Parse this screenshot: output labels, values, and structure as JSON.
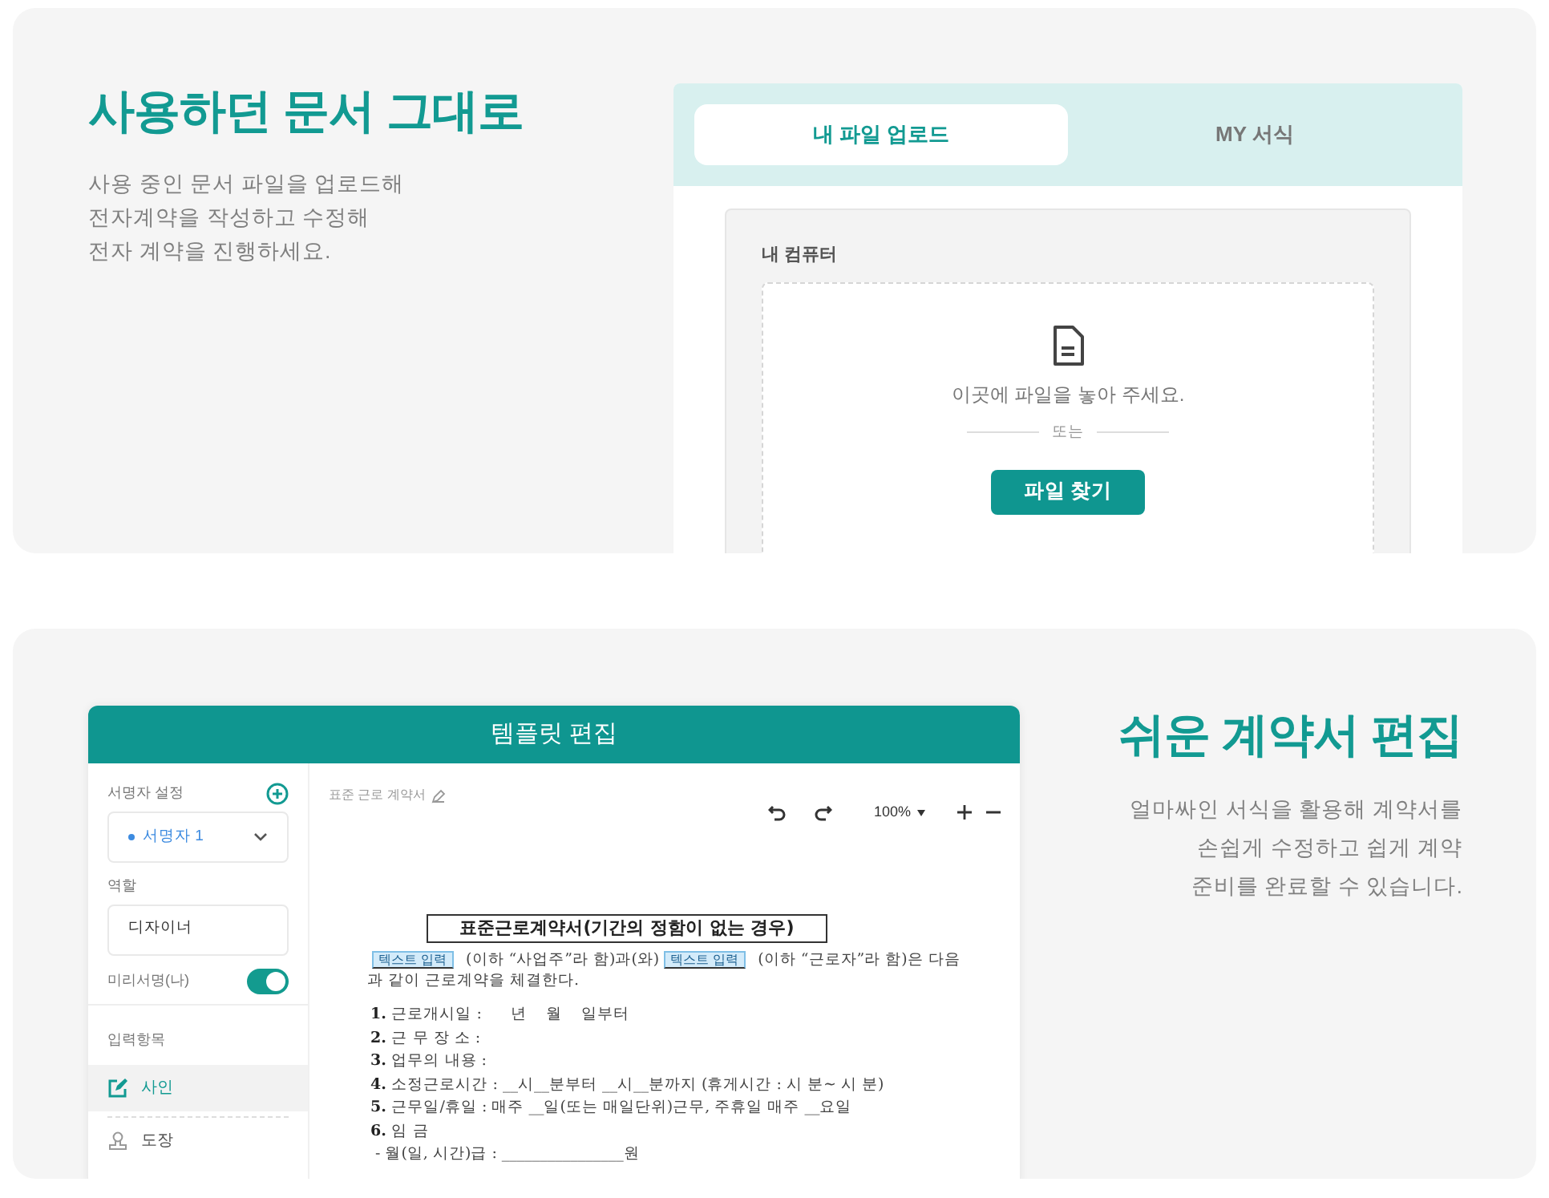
{
  "intro": {
    "title": "사용하던 문서 그대로",
    "lines": [
      "사용 중인 문서 파일을 업로드해",
      "전자계약을 작성하고 수정해",
      "전자 계약을 진행하세요."
    ]
  },
  "upload_panel": {
    "tabs": [
      {
        "label": "내 파일 업로드",
        "selected": true
      },
      {
        "label": "MY 서식",
        "selected": false
      }
    ],
    "source_label": "내 컴퓨터",
    "drop_hint": "이곳에 파일을 놓아 주세요.",
    "divider_label": "또는",
    "browse_button": "파일 찾기"
  },
  "editor": {
    "title": "템플릿 편집",
    "sidebar": {
      "signer_label": "서명자 설정",
      "signer_value": "서명자 1",
      "role_label": "역할",
      "role_value": "디자이너",
      "presign_label": "미리서명(나)",
      "presign_on": true,
      "fields_label": "입력항목",
      "fields": [
        {
          "kind": "sign",
          "label": "사인",
          "selected": true
        },
        {
          "kind": "stamp",
          "label": "도장",
          "selected": false
        }
      ]
    },
    "doc_name": "표준 근로 계약서",
    "zoom": "100%",
    "contract": {
      "title": "표준근로계약서(기간의 정함이 없는 경우)",
      "intro": [
        {
          "kind": "field",
          "text": "텍스트 입력"
        },
        {
          "kind": "text",
          "text": "(이하 “사업주”라 함)과(와)"
        },
        {
          "kind": "field",
          "text": "텍스트 입력"
        },
        {
          "kind": "text",
          "text": "(이하 “근로자”라 함)은 다음"
        }
      ],
      "intro_rest": "과 같이 근로계약을 체결한다.",
      "items": [
        {
          "number": "1.",
          "text": "근로개시일 :      년    월    일부터"
        },
        {
          "number": "2.",
          "text": "근 무 장 소 :"
        },
        {
          "number": "3.",
          "text": "업무의 내용 :"
        },
        {
          "number": "4.",
          "text": "소정근로시간 : __시__분부터 __시__분까지 (휴게시간 : 시 분~ 시 분)"
        },
        {
          "number": "5.",
          "text": "근무일/휴일 : 매주 __일(또는 매일단위)근무, 주휴일 매주 __요일"
        },
        {
          "number": "6.",
          "text": "임 금"
        }
      ],
      "sub_item": "- 월(일, 시간)급 : ________________원"
    }
  },
  "feature": {
    "title": "쉬운 계약서 편집",
    "lines": [
      "얼마싸인 서식을 활용해 계약서를",
      "손쉽게 수정하고 쉽게 계약",
      "준비를 완료할 수 있습니다."
    ]
  }
}
